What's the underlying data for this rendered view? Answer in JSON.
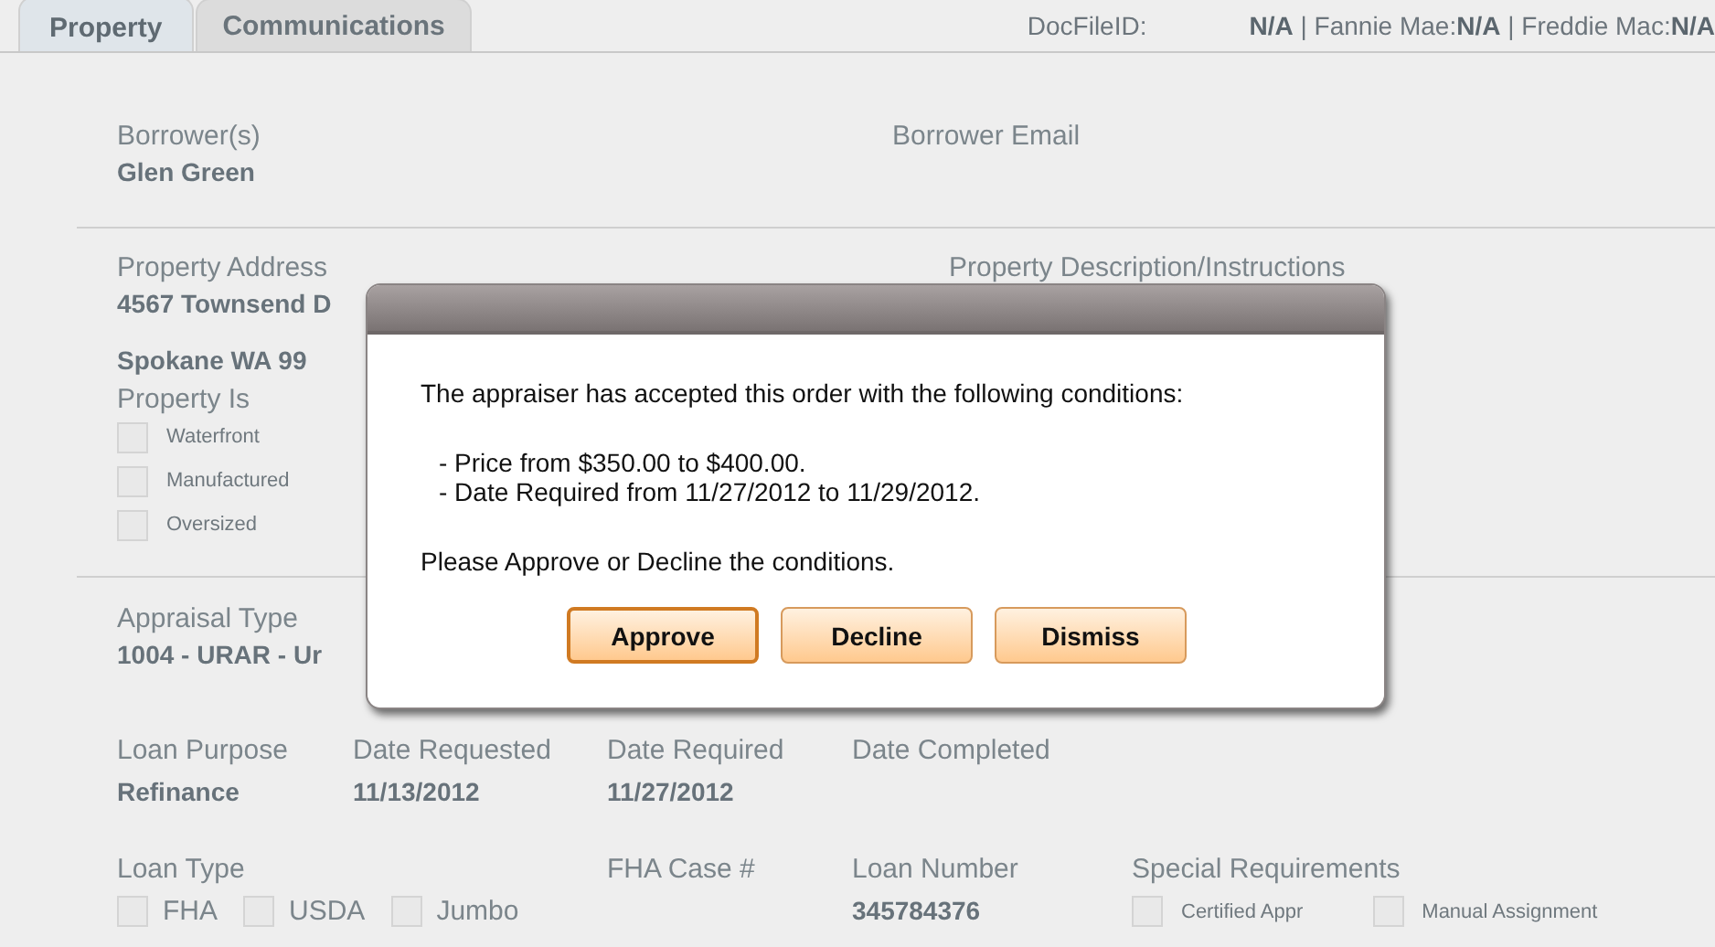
{
  "tabs": [
    {
      "label": "Property",
      "selected": true
    },
    {
      "label": "Communications",
      "selected": false
    }
  ],
  "header": {
    "doc_label": "DocFileID:",
    "doc_value": "**N/A** | Fannie Mae:**N/A** | Freddie Mac:**N/A**"
  },
  "borrower": {
    "label": "Borrower(s)",
    "value": "Glen Green",
    "email_label": "Borrower Email"
  },
  "property": {
    "address_label": "Property Address",
    "address_line1": "4567 Townsend D",
    "address_line2": "Spokane  WA 99",
    "description_label": "Property Description/Instructions",
    "property_is_label": "Property Is",
    "options": [
      {
        "label": "Waterfront",
        "checked": false
      },
      {
        "label": "Manufactured",
        "checked": false
      },
      {
        "label": "Oversized",
        "checked": false
      }
    ]
  },
  "appraisal": {
    "label": "Appraisal Type",
    "value": "1004 - URAR - Ur"
  },
  "loan_fields": [
    {
      "label": "Loan Purpose",
      "value": "Refinance"
    },
    {
      "label": "Date Requested",
      "value": "11/13/2012"
    },
    {
      "label": "Date Required",
      "value": "11/27/2012"
    },
    {
      "label": "Date Completed"
    }
  ],
  "loan_type": {
    "label": "Loan Type",
    "options": [
      {
        "label": "FHA",
        "checked": false
      },
      {
        "label": "USDA",
        "checked": false
      },
      {
        "label": "Jumbo",
        "checked": false
      }
    ]
  },
  "fha_case": {
    "label": "FHA Case #"
  },
  "loan_number": {
    "label": "Loan Number",
    "value": "345784376"
  },
  "special": {
    "label": "Special Requirements",
    "options": [
      {
        "label": "Certified Appr",
        "checked": false
      },
      {
        "label": "Manual Assignment",
        "checked": false
      }
    ]
  },
  "dialog": {
    "message": "The appraiser has accepted this order with the following conditions:",
    "conditions": [
      "- Price from $350.00 to $400.00.",
      "- Date Required from 11/27/2012 to 11/29/2012."
    ],
    "prompt": "Please Approve or Decline the conditions.",
    "buttons": [
      {
        "label": "Approve",
        "default": true
      },
      {
        "label": "Decline",
        "default": false
      },
      {
        "label": "Dismiss",
        "default": false
      }
    ]
  }
}
